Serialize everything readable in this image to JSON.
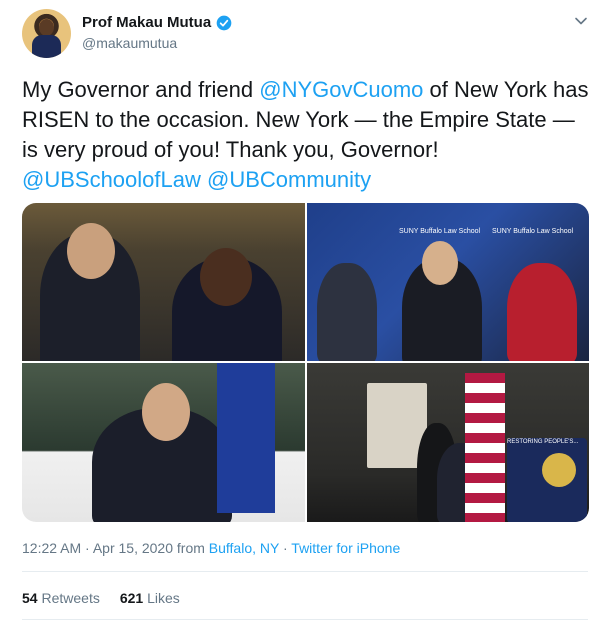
{
  "user": {
    "display_name": "Prof Makau Mutua",
    "handle": "@makaumutua",
    "verified": true,
    "avatar_icon": "profile-photo"
  },
  "tweet": {
    "segments": [
      {
        "text": "My Governor and friend ",
        "type": "text"
      },
      {
        "text": "@NYGovCuomo",
        "type": "mention"
      },
      {
        "text": " of New York has RISEN to the occasion.  New York — the Empire State — is very proud of you!  Thank you, Governor! ",
        "type": "text"
      },
      {
        "text": "@UBSchoolofLaw",
        "type": "mention"
      },
      {
        "text": " ",
        "type": "text"
      },
      {
        "text": "@UBCommunity",
        "type": "mention"
      }
    ]
  },
  "media": {
    "photo_count": 4,
    "overlay_texts": {
      "banner_1": "SUNY Buffalo Law School",
      "banner_2": "SUNY Buffalo Law School",
      "podium": "RESTORING PEOPLE'S..."
    }
  },
  "meta": {
    "time": "12:22 AM",
    "separator1": " · ",
    "date": "Apr 15, 2020",
    "from_label": " from ",
    "location": "Buffalo, NY",
    "separator2": " · ",
    "source": "Twitter for iPhone"
  },
  "stats": {
    "retweets_count": "54",
    "retweets_label": "Retweets",
    "likes_count": "621",
    "likes_label": "Likes"
  },
  "colors": {
    "accent": "#1da1f2",
    "text": "#14171a",
    "secondary": "#657786"
  }
}
